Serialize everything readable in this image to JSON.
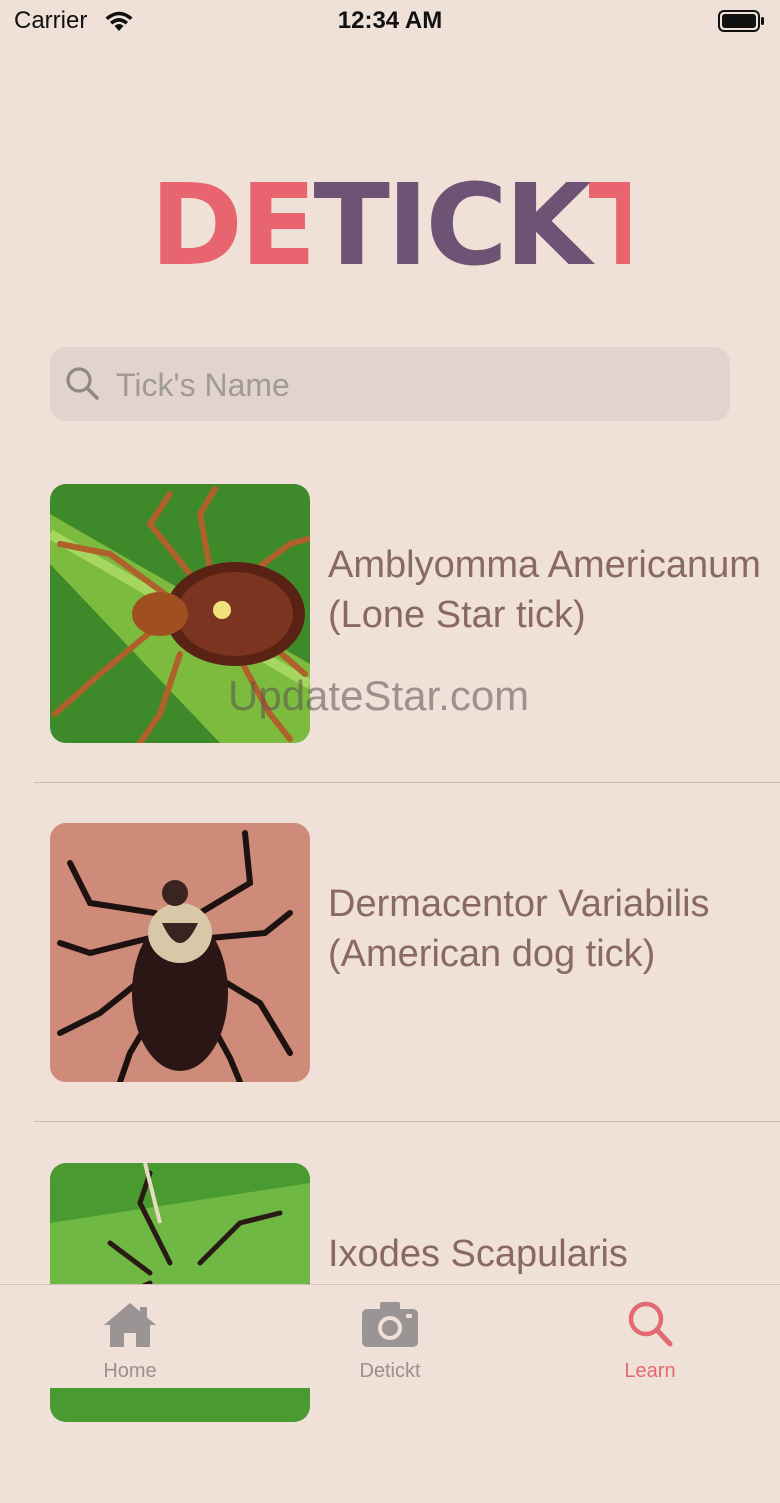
{
  "status": {
    "carrier": "Carrier",
    "time": "12:34 AM"
  },
  "logo": {
    "left": "DE",
    "middle": "TICK",
    "right": "T",
    "colors": {
      "pink": "#e8656f",
      "purple": "#6e5375"
    }
  },
  "search": {
    "placeholder": "Tick's Name",
    "value": ""
  },
  "ticks": [
    {
      "name": "Amblyomma Americanum (Lone Star tick)",
      "image": "lone-star-tick-photo"
    },
    {
      "name": "Dermacentor Variabilis (American dog tick)",
      "image": "american-dog-tick-photo"
    },
    {
      "name": "Ixodes Scapularis",
      "image": "blacklegged-tick-photo"
    }
  ],
  "watermark": "UpdateStar.com",
  "tabs": [
    {
      "label": "Home",
      "icon": "house-icon",
      "active": false
    },
    {
      "label": "Detickt",
      "icon": "camera-icon",
      "active": false
    },
    {
      "label": "Learn",
      "icon": "search-icon",
      "active": true
    }
  ],
  "theme": {
    "background": "#efe0d8",
    "accent": "#e26a72",
    "text": "#8a6a60"
  }
}
